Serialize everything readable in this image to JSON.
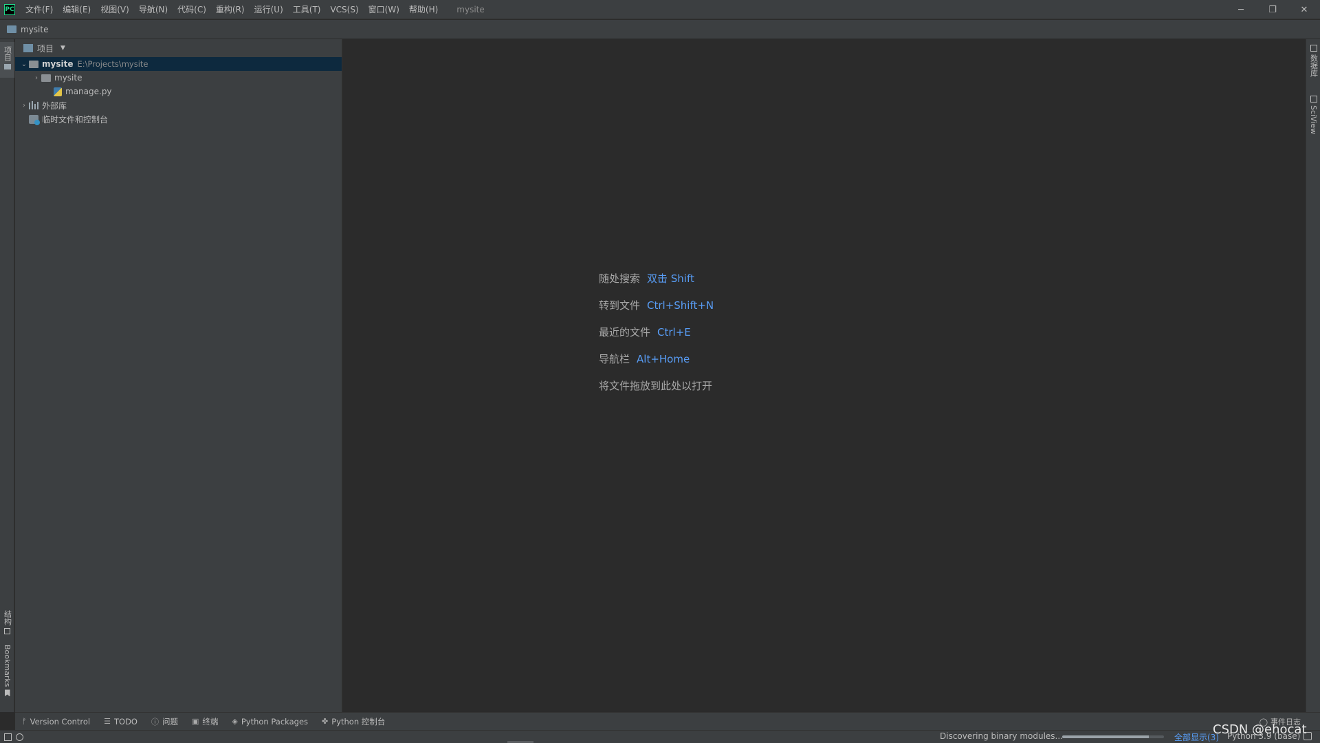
{
  "app": {
    "logo_text": "PC",
    "window_title": "mysite"
  },
  "menu": [
    {
      "label": "文件(F)"
    },
    {
      "label": "编辑(E)"
    },
    {
      "label": "视图(V)"
    },
    {
      "label": "导航(N)"
    },
    {
      "label": "代码(C)"
    },
    {
      "label": "重构(R)"
    },
    {
      "label": "运行(U)"
    },
    {
      "label": "工具(T)"
    },
    {
      "label": "VCS(S)"
    },
    {
      "label": "窗口(W)"
    },
    {
      "label": "帮助(H)"
    }
  ],
  "window_controls": {
    "minimize": "─",
    "restore": "❐",
    "close": "✕"
  },
  "navbar": {
    "breadcrumb": "mysite"
  },
  "left_stripe": {
    "project_label": "项目",
    "structure_label": "结构",
    "bookmarks_label": "Bookmarks"
  },
  "project_panel": {
    "header_label": "项目",
    "tree": [
      {
        "label": "mysite",
        "path": "E:\\Projects\\mysite"
      },
      {
        "label": "mysite"
      },
      {
        "label": "manage.py"
      },
      {
        "label": "外部库"
      },
      {
        "label": "临时文件和控制台"
      }
    ]
  },
  "editor_hints": [
    {
      "text": "随处搜索",
      "key": "双击 Shift"
    },
    {
      "text": "转到文件",
      "key": "Ctrl+Shift+N"
    },
    {
      "text": "最近的文件",
      "key": "Ctrl+E"
    },
    {
      "text": "导航栏",
      "key": "Alt+Home"
    },
    {
      "text": "将文件拖放到此处以打开",
      "key": ""
    }
  ],
  "right_stripe": {
    "database_label": "数据库",
    "sciview_label": "SciView"
  },
  "tool_windows": [
    {
      "label": "Version Control",
      "icon": "branch-icon"
    },
    {
      "label": "TODO",
      "icon": "list-icon"
    },
    {
      "label": "问题",
      "icon": "info-icon"
    },
    {
      "label": "终端",
      "icon": "terminal-icon"
    },
    {
      "label": "Python Packages",
      "icon": "layers-icon"
    },
    {
      "label": "Python 控制台",
      "icon": "python-icon"
    }
  ],
  "event_log_label": "事件日志",
  "status_bar": {
    "progress_text": "Discovering binary modules...",
    "progress_fraction": 0.85,
    "show_all": "全部显示(3)",
    "interpreter": "Python 3.9 (base)"
  },
  "watermark": "CSDN @ehocat"
}
